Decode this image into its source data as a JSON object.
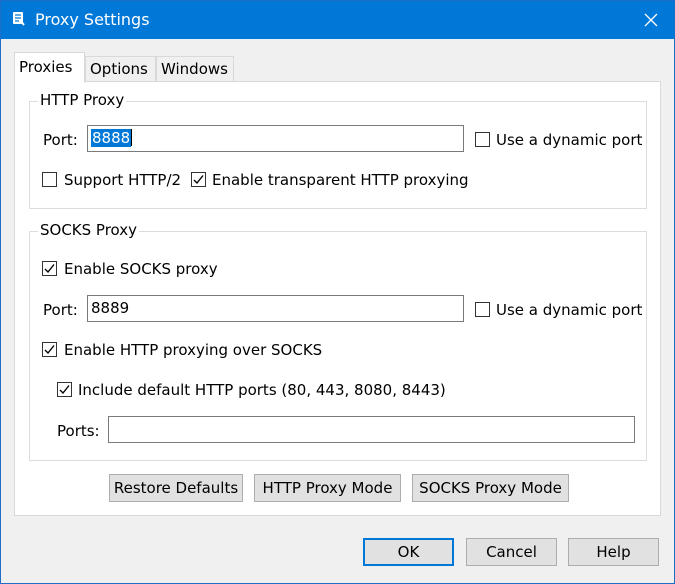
{
  "window": {
    "title": "Proxy Settings"
  },
  "icons": {
    "app": "fiddler-app-icon",
    "close": "close-icon",
    "check": "checkmark-icon"
  },
  "tabs": [
    {
      "label": "Proxies",
      "active": true
    },
    {
      "label": "Options",
      "active": false
    },
    {
      "label": "Windows",
      "active": false
    }
  ],
  "http_proxy": {
    "legend": "HTTP Proxy",
    "port_label": "Port:",
    "port_value": "8888",
    "dynamic_port_label": "Use a dynamic port",
    "dynamic_port_checked": false,
    "support_http2_label": "Support HTTP/2",
    "support_http2_checked": false,
    "transparent_label": "Enable transparent HTTP proxying",
    "transparent_checked": true
  },
  "socks_proxy": {
    "legend": "SOCKS Proxy",
    "enable_label": "Enable SOCKS proxy",
    "enable_checked": true,
    "port_label": "Port:",
    "port_value": "8889",
    "dynamic_port_label": "Use a dynamic port",
    "dynamic_port_checked": false,
    "http_over_socks_label": "Enable HTTP proxying over SOCKS",
    "http_over_socks_checked": true,
    "include_default_ports_label": "Include default HTTP ports (80, 443, 8080, 8443)",
    "include_default_ports_checked": true,
    "ports_label": "Ports:",
    "ports_value": ""
  },
  "panel_buttons": {
    "restore_defaults": "Restore Defaults",
    "http_proxy_mode": "HTTP Proxy Mode",
    "socks_proxy_mode": "SOCKS Proxy Mode"
  },
  "dialog_buttons": {
    "ok": "OK",
    "cancel": "Cancel",
    "help": "Help"
  }
}
